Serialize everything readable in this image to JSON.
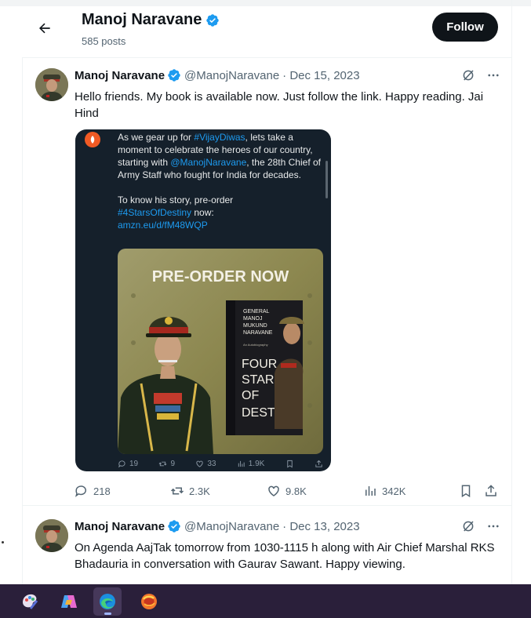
{
  "header": {
    "name": "Manoj Naravane",
    "post_count": "585 posts",
    "follow_label": "Follow"
  },
  "tweets": [
    {
      "author": "Manoj Naravane",
      "handle": "@ManojNaravane",
      "date": "· Dec 15, 2023",
      "text": "Hello friends. My book is available now. Just follow the link. Happy reading. Jai Hind",
      "media": {
        "line1_pre": "As we gear up for ",
        "line1_tag": "#VijayDiwas",
        "line1_post": ", lets take a moment to celebrate the heroes of our country, starting with ",
        "mention": "@ManojNaravane",
        "line2": ", the 28th Chief of Army Staff who fought for India for decades.",
        "line3": "To know his story, pre-order",
        "tag2": "#4StarsOfDestiny",
        "line3_post": " now:",
        "link": "amzn.eu/d/fM48WQP",
        "poster_title": "PRE-ORDER NOW",
        "book_author": [
          "GENERAL",
          "MANOJ",
          "MUKUND",
          "NARAVANE"
        ],
        "book_title": [
          "FOUR",
          "STARS",
          "OF",
          "DESTINY"
        ],
        "book_subtitle": "An Autobiography",
        "stats": {
          "replies": "19",
          "reposts": "9",
          "likes": "33",
          "views": "1.9K"
        }
      },
      "actions": {
        "replies": "218",
        "reposts": "2.3K",
        "likes": "9.8K",
        "views": "342K"
      }
    },
    {
      "author": "Manoj Naravane",
      "handle": "@ManojNaravane",
      "date": "· Dec 13, 2023",
      "text": "On Agenda AajTak tomorrow from 1030-1115 h along with Air Chief Marshal RKS Bhadauria in conversation with Gaurav Sawant. Happy viewing."
    }
  ],
  "taskbar": {
    "items": [
      "paint-app-icon",
      "copilot-icon",
      "edge-browser-icon",
      "firefox-icon"
    ],
    "active": "edge-browser-icon"
  },
  "colors": {
    "accent": "#1d9bf0",
    "text_primary": "#0f1419",
    "text_secondary": "#536471",
    "taskbar": "#2a1f3a"
  }
}
